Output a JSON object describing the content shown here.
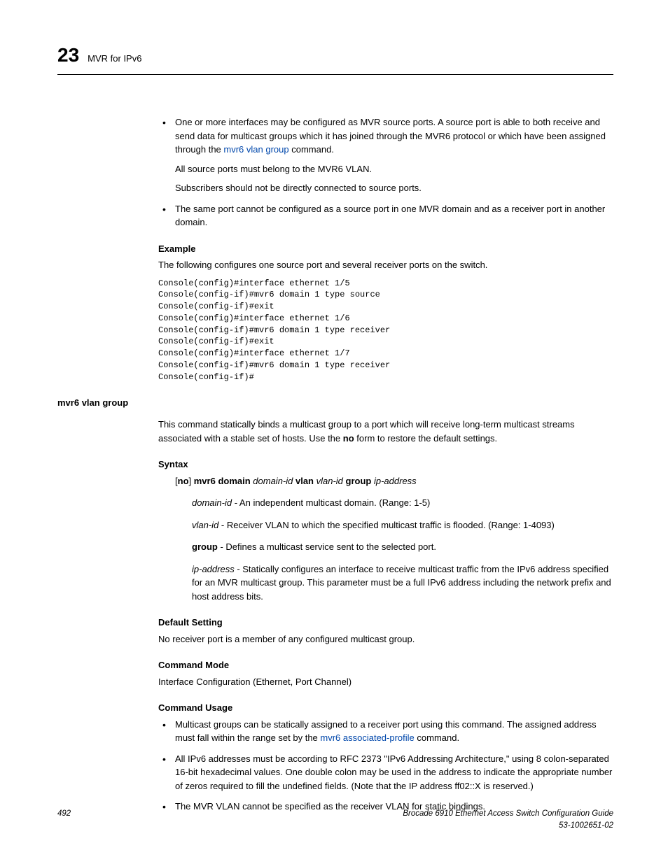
{
  "header": {
    "chapter_num": "23",
    "section_title": "MVR for IPv6"
  },
  "bullets_top": {
    "b1_part1": "One or more interfaces may be configured as MVR source ports. A source port is able to both receive and send data for multicast groups which it has joined through the MVR6 protocol or which have been assigned through the ",
    "b1_link": "mvr6 vlan group",
    "b1_part2": " command.",
    "b1_sub1": "All source ports must belong to the MVR6 VLAN.",
    "b1_sub2": "Subscribers should not be directly connected to source ports.",
    "b2": "The same port cannot be configured as a source port in one MVR domain and as a receiver port in another domain."
  },
  "example": {
    "heading": "Example",
    "intro": "The following configures one source port and several receiver ports on the switch.",
    "code": "Console(config)#interface ethernet 1/5\nConsole(config-if)#mvr6 domain 1 type source\nConsole(config-if)#exit\nConsole(config)#interface ethernet 1/6\nConsole(config-if)#mvr6 domain 1 type receiver\nConsole(config-if)#exit\nConsole(config)#interface ethernet 1/7\nConsole(config-if)#mvr6 domain 1 type receiver\nConsole(config-if)#"
  },
  "command": {
    "name": "mvr6 vlan group",
    "desc_part1": "This command statically binds a multicast group to a port which will receive long-term multicast streams associated with a stable set of hosts. Use the ",
    "desc_bold": "no",
    "desc_part2": " form to restore the default settings."
  },
  "syntax": {
    "heading": "Syntax",
    "line_no": "no",
    "line_part1": "] ",
    "line_bold1": "mvr6 domain",
    "line_it1": " domain-id ",
    "line_bold2": "vlan",
    "line_it2": " vlan-id ",
    "line_bold3": "group",
    "line_it3": " ip-address",
    "domain_it": "domain-id",
    "domain_txt": " - An independent multicast domain. (Range: 1-5)",
    "vlan_it": "vlan-id",
    "vlan_txt": " - Receiver VLAN to which the specified multicast traffic is flooded. (Range: 1-4093)",
    "group_bold": "group",
    "group_txt": " - Defines a multicast service sent to the selected port.",
    "ip_it": "ip-address",
    "ip_txt": " - Statically configures an interface to receive multicast traffic from the IPv6 address specified for an MVR multicast group. This parameter must be a full IPv6 address including the network prefix and host address bits."
  },
  "default_setting": {
    "heading": "Default Setting",
    "text": "No receiver port is a member of any configured multicast group."
  },
  "command_mode": {
    "heading": "Command Mode",
    "text": "Interface Configuration (Ethernet, Port Channel)"
  },
  "command_usage": {
    "heading": "Command Usage",
    "b1_part1": "Multicast groups can be statically assigned to a receiver port using this command. The assigned address must fall within the range set by the ",
    "b1_link": "mvr6 associated-profile",
    "b1_part2": " command.",
    "b2": "All IPv6 addresses must be according to RFC 2373 \"IPv6 Addressing Architecture,\" using 8 colon-separated 16-bit hexadecimal values. One double colon may be used in the address to indicate the appropriate number of zeros required to fill the undefined fields. (Note that the IP address ff02::X is reserved.)",
    "b3": "The MVR VLAN cannot be specified as the receiver VLAN for static bindings."
  },
  "footer": {
    "page": "492",
    "guide": "Brocade 6910 Ethernet Access Switch Configuration Guide",
    "docnum": "53-1002651-02"
  }
}
